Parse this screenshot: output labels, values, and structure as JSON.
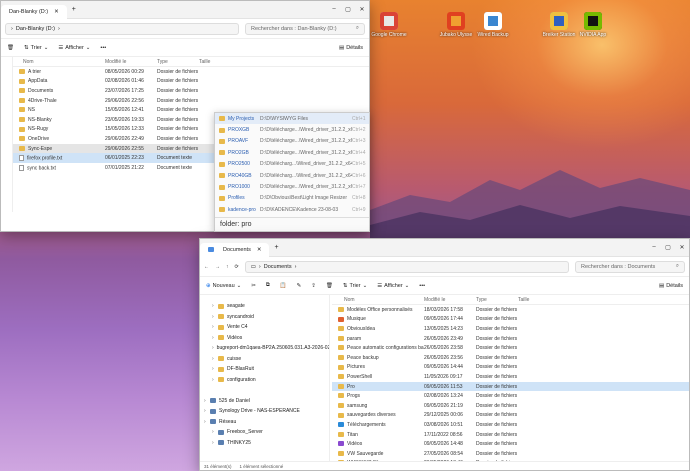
{
  "desktop": {
    "icons": [
      {
        "label": "Google Chrome",
        "color": "#e8e8e8",
        "accent": "#db4437"
      },
      {
        "label": "Jubako Ulysse",
        "color": "#f0a030",
        "accent": "#e04020"
      },
      {
        "label": "Wired Backup",
        "color": "#3a86d0",
        "accent": "#ffffff"
      },
      {
        "label": "Breiker Station",
        "color": "#2f60c0",
        "accent": "#f0c040"
      },
      {
        "label": "NVIDIA App",
        "color": "#111111",
        "accent": "#76b900"
      }
    ]
  },
  "win1": {
    "tab_title": "Dan-Blanky (D:)",
    "search_placeholder": "Rechercher dans : Dan-Blanky (D:)",
    "toolbar": {
      "sort": "Trier",
      "view": "Afficher",
      "more": "•••",
      "details": "Détails"
    },
    "columns": {
      "name": "Nom",
      "modified": "Modifié le",
      "type": "Type",
      "size": "Taille"
    },
    "rows": [
      {
        "icon": "folder",
        "name": "A trier",
        "date": "08/05/2026 00:29",
        "type": "Dossier de fichiers"
      },
      {
        "icon": "folder",
        "name": "AppData",
        "date": "02/08/2026 01:46",
        "type": "Dossier de fichiers"
      },
      {
        "icon": "folder",
        "name": "Documents",
        "date": "23/07/2026 17:25",
        "type": "Dossier de fichiers"
      },
      {
        "icon": "folder",
        "name": "4Drive-Thale",
        "date": "29/06/2026 22:56",
        "type": "Dossier de fichiers"
      },
      {
        "icon": "folder",
        "name": "NS",
        "date": "15/05/2026 12:41",
        "type": "Dossier de fichiers"
      },
      {
        "icon": "folder",
        "name": "NS-Blanky",
        "date": "23/05/2026 19:33",
        "type": "Dossier de fichiers"
      },
      {
        "icon": "folder",
        "name": "NS-Rugy",
        "date": "15/05/2026 12:33",
        "type": "Dossier de fichiers"
      },
      {
        "icon": "folder",
        "name": "OneDrive",
        "date": "29/06/2026 22:49",
        "type": "Dossier de fichiers"
      },
      {
        "icon": "folder",
        "name": "Sync-Espe",
        "date": "29/06/2026 22:55",
        "type": "Dossier de fichiers"
      },
      {
        "icon": "doc",
        "name": "firefox profile.txt",
        "date": "06/01/2025 22:23",
        "type": "Document texte"
      },
      {
        "icon": "doc",
        "name": "sync back.txt",
        "date": "07/01/2025 21:22",
        "type": "Document texte"
      }
    ]
  },
  "popup": {
    "items": [
      {
        "name": "My Projects",
        "path": "D:\\D\\WYSIWYG Files",
        "key": "Ctrl+1"
      },
      {
        "name": "PROXGB",
        "path": "D:\\D\\télécharge...\\Wired_driver_31.2.2_x64",
        "key": "Ctrl+2"
      },
      {
        "name": "PROAVF",
        "path": "D:\\D\\télécharge...\\Wired_driver_31.2.2_x64",
        "key": "Ctrl+3"
      },
      {
        "name": "PRO2GB",
        "path": "D:\\D\\télécharge...\\Wired_driver_31.2.2_x64",
        "key": "Ctrl+4"
      },
      {
        "name": "PRO2500",
        "path": "D:\\D\\télécharg...\\Wired_driver_31.2.2_x64",
        "key": "Ctrl+5"
      },
      {
        "name": "PRO40GB",
        "path": "D:\\D\\télécharg...\\Wired_driver_31.2.2_x64",
        "key": "Ctrl+6"
      },
      {
        "name": "PRO1000",
        "path": "D:\\D\\télécharge...\\Wired_driver_31.2.2_x64",
        "key": "Ctrl+7"
      },
      {
        "name": "Profiles",
        "path": "D:\\D\\Obvious\\Best\\Light Image Resizer",
        "key": "Ctrl+8"
      },
      {
        "name": "kadence-pro",
        "path": "D:\\D\\KADENCE\\Kadence 23-08-03",
        "key": "Ctrl+9"
      }
    ],
    "query": "folder: pro"
  },
  "win2": {
    "tab_title": "Documents",
    "breadcrumb": "Documents",
    "search_placeholder": "Rechercher dans : Documents",
    "toolbar": {
      "new": "Nouveau",
      "sort": "Trier",
      "view": "Afficher",
      "more": "•••",
      "details": "Détails"
    },
    "nav": [
      {
        "indent": 1,
        "icon": "folder",
        "label": "seagate"
      },
      {
        "indent": 1,
        "icon": "folder",
        "label": "syncandroid"
      },
      {
        "indent": 1,
        "icon": "folder",
        "label": "Vente C4"
      },
      {
        "indent": 1,
        "icon": "folder",
        "label": "Vidéos"
      },
      {
        "indent": 1,
        "icon": "folder",
        "label": "bugreport-dm1qaea-BP2A.250605.031.A3-2026-02-1"
      },
      {
        "indent": 1,
        "icon": "folder",
        "label": "cuisse"
      },
      {
        "indent": 1,
        "icon": "folder",
        "label": "DF-BlasRuit"
      },
      {
        "indent": 1,
        "icon": "folder",
        "label": "configuration"
      },
      {
        "indent": 0,
        "icon": "blank",
        "label": ""
      },
      {
        "indent": 0,
        "icon": "drive",
        "label": "525 de Daniel"
      },
      {
        "indent": 0,
        "icon": "drive",
        "label": "Synology Drive - NAS-ESPERANCE"
      },
      {
        "indent": 0,
        "icon": "net",
        "label": "Réseau"
      },
      {
        "indent": 1,
        "icon": "pc",
        "label": "Freebox_Server"
      },
      {
        "indent": 1,
        "icon": "pc",
        "label": "THINKY25"
      }
    ],
    "columns": {
      "name": "Nom",
      "modified": "Modifié le",
      "type": "Type",
      "size": "Taille"
    },
    "rows": [
      {
        "icon": "folder",
        "name": "Modèles Office personnalisés",
        "date": "18/03/2026 17:58",
        "type": "Dossier de fichiers"
      },
      {
        "icon": "music",
        "name": "Musique",
        "date": "09/05/2026 17:44",
        "type": "Dossier de fichiers"
      },
      {
        "icon": "folder",
        "name": "ObviousIdea",
        "date": "13/05/2025 14:23",
        "type": "Dossier de fichiers"
      },
      {
        "icon": "folder",
        "name": "param",
        "date": "26/05/2026 23:49",
        "type": "Dossier de fichiers"
      },
      {
        "icon": "folder",
        "name": "Peace automatic configurations backup",
        "date": "26/05/2026 23:58",
        "type": "Dossier de fichiers"
      },
      {
        "icon": "folder",
        "name": "Peace backup",
        "date": "26/05/2026 23:56",
        "type": "Dossier de fichiers"
      },
      {
        "icon": "folder",
        "name": "Pictures",
        "date": "09/05/2026 14:44",
        "type": "Dossier de fichiers"
      },
      {
        "icon": "folder",
        "name": "PowerShell",
        "date": "11/05/2026 09:17",
        "type": "Dossier de fichiers"
      },
      {
        "icon": "folder",
        "name": "Pro",
        "date": "09/05/2026 11:53",
        "type": "Dossier de fichiers"
      },
      {
        "icon": "folder",
        "name": "Progs",
        "date": "02/08/2026 13:24",
        "type": "Dossier de fichiers"
      },
      {
        "icon": "folder",
        "name": "samsung",
        "date": "09/05/2026 21:19",
        "type": "Dossier de fichiers"
      },
      {
        "icon": "folder",
        "name": "sauvegardes diverses",
        "date": "29/12/2025 00:06",
        "type": "Dossier de fichiers"
      },
      {
        "icon": "download",
        "name": "Téléchargements",
        "date": "03/08/2026 10:51",
        "type": "Dossier de fichiers"
      },
      {
        "icon": "folder",
        "name": "Titan",
        "date": "17/11/2022 08:56",
        "type": "Dossier de fichiers"
      },
      {
        "icon": "video",
        "name": "Vidéos",
        "date": "09/05/2026 14:48",
        "type": "Dossier de fichiers"
      },
      {
        "icon": "folder",
        "name": "VW Sauvegarde",
        "date": "27/05/2026 08:54",
        "type": "Dossier de fichiers"
      },
      {
        "icon": "folder",
        "name": "WYSIWYG Files",
        "date": "26/05/2026 13:46",
        "type": "Dossier de fichiers"
      }
    ],
    "status": {
      "count": "31 élément(s)",
      "selected": "1 élément sélectionné"
    }
  }
}
